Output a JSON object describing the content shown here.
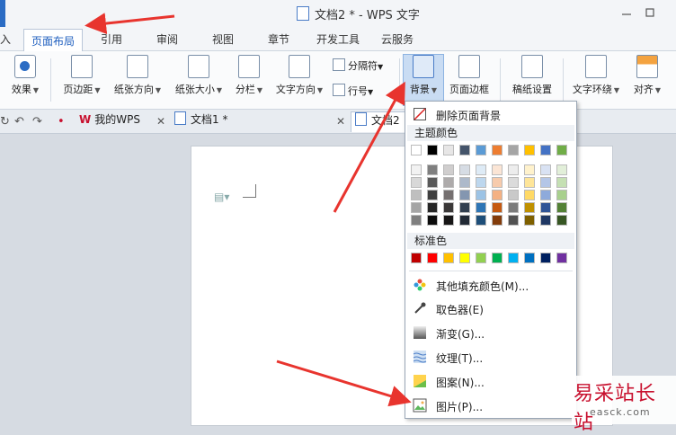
{
  "window": {
    "title": "文档2 * - WPS 文字"
  },
  "menu_tabs": [
    {
      "label": "入"
    },
    {
      "label": "页面布局"
    },
    {
      "label": "引用"
    },
    {
      "label": "审阅"
    },
    {
      "label": "视图"
    },
    {
      "label": "章节"
    },
    {
      "label": "开发工具"
    },
    {
      "label": "云服务"
    }
  ],
  "ribbon": {
    "effects": "效果",
    "margins": "页边距",
    "orientation": "纸张方向",
    "size": "纸张大小",
    "columns": "分栏",
    "text_direction": "文字方向",
    "separator": "分隔符",
    "line_number": "行号",
    "background": "背景",
    "page_border": "页面边框",
    "manuscript": "稿纸设置",
    "wrap": "文字环绕",
    "align": "对齐"
  },
  "doc_tabs": [
    {
      "label": "我的WPS"
    },
    {
      "label": "文档1 *"
    },
    {
      "label": "文档2"
    }
  ],
  "dropdown": {
    "remove_bg": "删除页面背景",
    "theme_colors_title": "主题颜色",
    "standard_colors_title": "标准色",
    "more_fill": "其他填充颜色(M)...",
    "eyedropper": "取色器(E)",
    "gradient": "渐变(G)...",
    "texture": "纹理(T)...",
    "pattern": "图案(N)...",
    "picture": "图片(P)...",
    "theme_top": [
      "#ffffff",
      "#000000",
      "#e7e6e6",
      "#44546a",
      "#5b9bd5",
      "#ed7d31",
      "#a5a5a5",
      "#ffc000",
      "#4472c4",
      "#70ad47"
    ],
    "theme_shades": [
      [
        "#f2f2f2",
        "#7f7f7f",
        "#d0cece",
        "#d6dce4",
        "#deebf6",
        "#fbe5d5",
        "#ededed",
        "#fff2cc",
        "#d9e2f3",
        "#e2efd9"
      ],
      [
        "#d8d8d8",
        "#595959",
        "#aeabab",
        "#adb9ca",
        "#bdd7ee",
        "#f7cbac",
        "#dbdbdb",
        "#fee599",
        "#b4c6e7",
        "#c5e0b3"
      ],
      [
        "#bfbfbf",
        "#3f3f3f",
        "#757070",
        "#8496b0",
        "#9cc3e5",
        "#f4b183",
        "#c9c9c9",
        "#ffd965",
        "#8eaadb",
        "#a8d08d"
      ],
      [
        "#a5a5a5",
        "#262626",
        "#3a3838",
        "#323f4f",
        "#2e75b5",
        "#c55a11",
        "#7b7b7b",
        "#bf9000",
        "#2f5496",
        "#538135"
      ],
      [
        "#7f7f7f",
        "#0c0c0c",
        "#171616",
        "#222a35",
        "#1e4e79",
        "#833c0b",
        "#525252",
        "#7f6000",
        "#1f3864",
        "#375623"
      ]
    ],
    "standard": [
      "#c00000",
      "#ff0000",
      "#ffc000",
      "#ffff00",
      "#92d050",
      "#00b050",
      "#00b0f0",
      "#0070c0",
      "#002060",
      "#7030a0"
    ]
  },
  "watermark": {
    "line1": "易采站长站",
    "line2": "easck.com"
  }
}
